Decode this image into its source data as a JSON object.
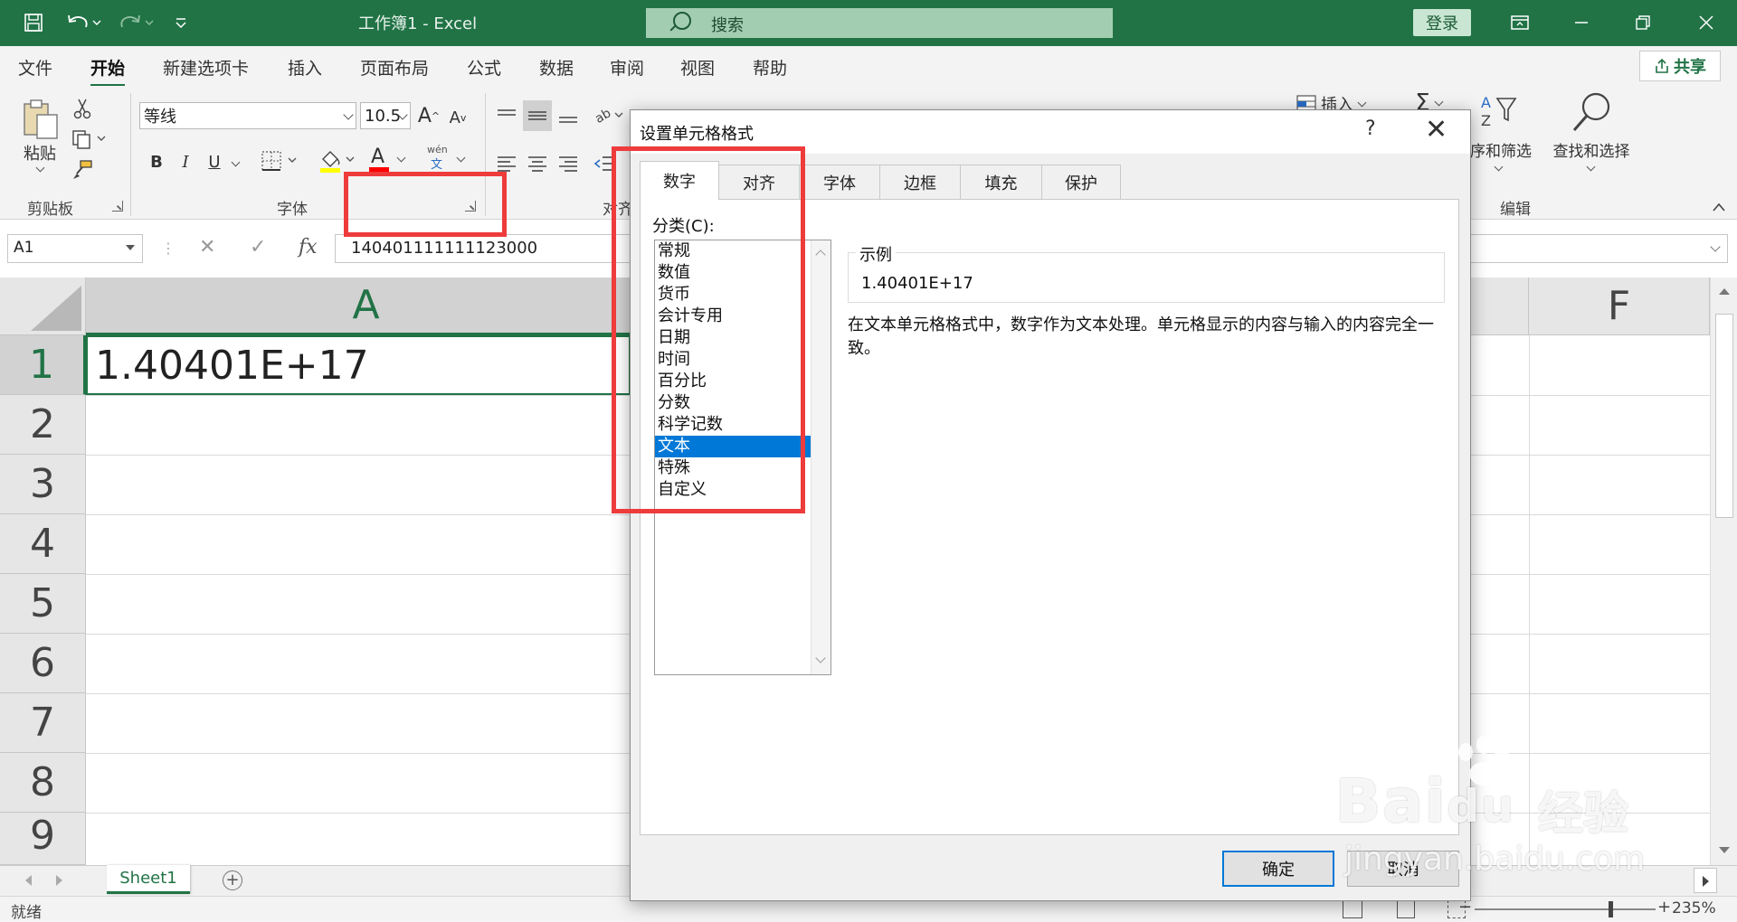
{
  "titlebar": {
    "title": "工作簿1  -  Excel",
    "search_placeholder": "搜索",
    "login": "登录"
  },
  "tabs": [
    "文件",
    "开始",
    "新建选项卡",
    "插入",
    "页面布局",
    "公式",
    "数据",
    "审阅",
    "视图",
    "帮助"
  ],
  "active_tab": "开始",
  "share": "共享",
  "ribbon": {
    "clipboard": {
      "paste": "粘贴",
      "label": "剪贴板"
    },
    "font": {
      "name": "等线",
      "size": "10.5",
      "grow": "A",
      "shrink": "A",
      "bold": "B",
      "italic": "I",
      "underline": "U",
      "font_color": "A",
      "phonetic_top": "wén",
      "phonetic_bottom": "文",
      "label": "字体"
    },
    "align_label_partial": "对齐",
    "insert": "插入",
    "sort_filter": "排序和筛选",
    "find_select": "查找和选择",
    "edit_label": "编辑"
  },
  "formula_bar": {
    "namebox": "A1",
    "cancel": "✕",
    "enter": "✓",
    "fx": "fx",
    "content": "140401111111123000"
  },
  "grid": {
    "columns": [
      "A",
      "F"
    ],
    "rows": [
      "1",
      "2",
      "3",
      "4",
      "5",
      "6",
      "7",
      "8",
      "9"
    ],
    "a1_value": "1.40401E+17"
  },
  "sheet_tab": "Sheet1",
  "add_sheet": "+",
  "status": {
    "ready": "就绪",
    "zoom": "235%",
    "zoom_level": 0.75,
    "minus": "−",
    "plus": "+"
  },
  "dialog": {
    "title": "设置单元格格式",
    "help": "?",
    "close": "✕",
    "tabs": [
      "数字",
      "对齐",
      "字体",
      "边框",
      "填充",
      "保护"
    ],
    "active_tab": "数字",
    "category_label": "分类(C):",
    "categories": [
      "常规",
      "数值",
      "货币",
      "会计专用",
      "日期",
      "时间",
      "百分比",
      "分数",
      "科学记数",
      "文本",
      "特殊",
      "自定义"
    ],
    "selected_category": "文本",
    "sample_label": "示例",
    "sample_value": "1.40401E+17",
    "description": "在文本单元格格式中，数字作为文本处理。单元格显示的内容与输入的内容完全一致。",
    "ok": "确定",
    "cancel": "取消"
  },
  "watermark": {
    "brand": "Bai",
    "brand2": "du",
    "suffix": "经验",
    "url": "jingyan.baidu.com"
  },
  "colors": {
    "excel_green": "#217346",
    "selection_blue": "#0078d7",
    "annotation_red": "#ee3b3b"
  }
}
